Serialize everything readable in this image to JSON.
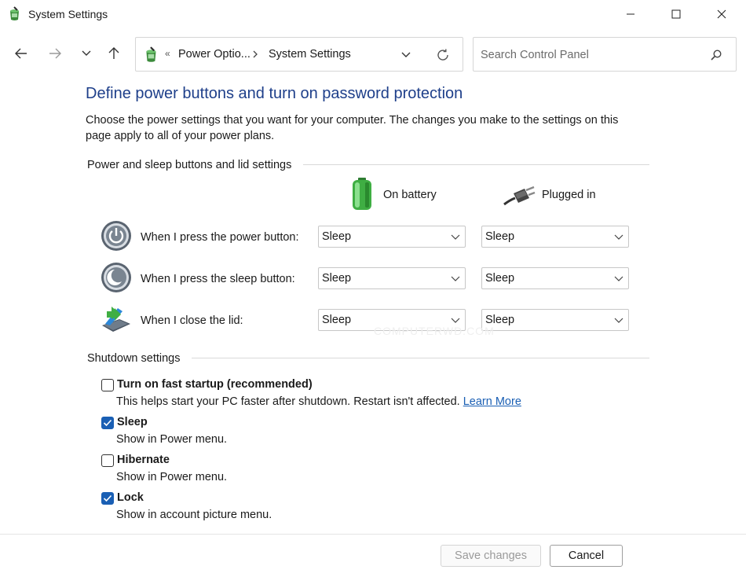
{
  "window": {
    "title": "System Settings"
  },
  "nav": {
    "breadcrumb_prefix": "«",
    "crumbs": [
      "Power Optio...",
      "System Settings"
    ],
    "search_placeholder": "Search Control Panel"
  },
  "page": {
    "title": "Define power buttons and turn on password protection",
    "description": "Choose the power settings that you want for your computer. The changes you make to the settings on this page apply to all of your power plans."
  },
  "power_group": {
    "header": "Power and sleep buttons and lid settings",
    "columns": {
      "battery": "On battery",
      "plugged": "Plugged in"
    },
    "rows": [
      {
        "label": "When I press the power button:",
        "battery": "Sleep",
        "plugged": "Sleep"
      },
      {
        "label": "When I press the sleep button:",
        "battery": "Sleep",
        "plugged": "Sleep"
      },
      {
        "label": "When I close the lid:",
        "battery": "Sleep",
        "plugged": "Sleep"
      }
    ]
  },
  "shutdown_group": {
    "header": "Shutdown settings",
    "items": [
      {
        "label": "Turn on fast startup (recommended)",
        "checked": false,
        "desc": "This helps start your PC faster after shutdown. Restart isn't affected.",
        "link": "Learn More"
      },
      {
        "label": "Sleep",
        "checked": true,
        "desc": "Show in Power menu."
      },
      {
        "label": "Hibernate",
        "checked": false,
        "desc": "Show in Power menu."
      },
      {
        "label": "Lock",
        "checked": true,
        "desc": "Show in account picture menu."
      }
    ]
  },
  "watermark": "COMPUTERWD.COM",
  "footer": {
    "save_label": "Save changes",
    "cancel_label": "Cancel"
  },
  "colors": {
    "title_blue": "#1e3f8a",
    "accent": "#1a5fb4"
  }
}
